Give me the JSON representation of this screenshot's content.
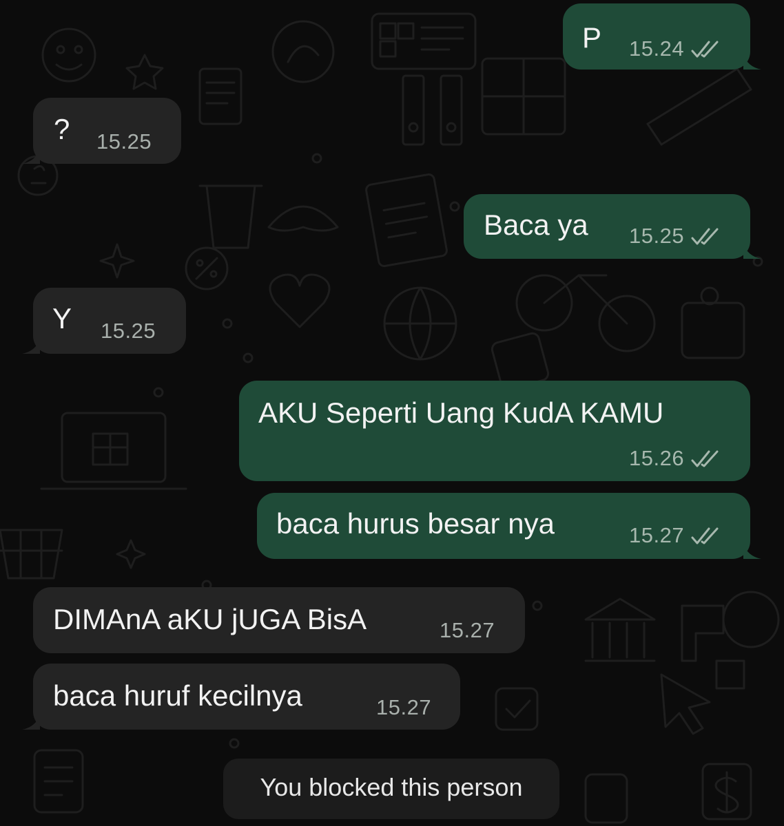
{
  "colors": {
    "background": "#0c0c0c",
    "outgoing_bubble": "#1f4b38",
    "incoming_bubble": "#242424",
    "timestamp": "#a9b0ac",
    "message_text": "#f2f2f2"
  },
  "icons": {
    "read_receipt": "double-check-icon"
  },
  "messages": [
    {
      "direction": "outgoing",
      "text": "P",
      "time": "15.24",
      "status": "read"
    },
    {
      "direction": "incoming",
      "text": "?",
      "time": "15.25"
    },
    {
      "direction": "outgoing",
      "text": "Baca ya",
      "time": "15.25",
      "status": "read"
    },
    {
      "direction": "incoming",
      "text": "Y",
      "time": "15.25"
    },
    {
      "direction": "outgoing",
      "text": "AKU Seperti Uang KudA KAMU",
      "time": "15.26",
      "status": "read"
    },
    {
      "direction": "outgoing",
      "text": "baca hurus besar nya",
      "time": "15.27",
      "status": "read"
    },
    {
      "direction": "incoming",
      "text": "DIMAnA aKU jUGA BisA",
      "time": "15.27"
    },
    {
      "direction": "incoming",
      "text": "baca huruf kecilnya",
      "time": "15.27"
    }
  ],
  "system_notice": "You blocked this person"
}
